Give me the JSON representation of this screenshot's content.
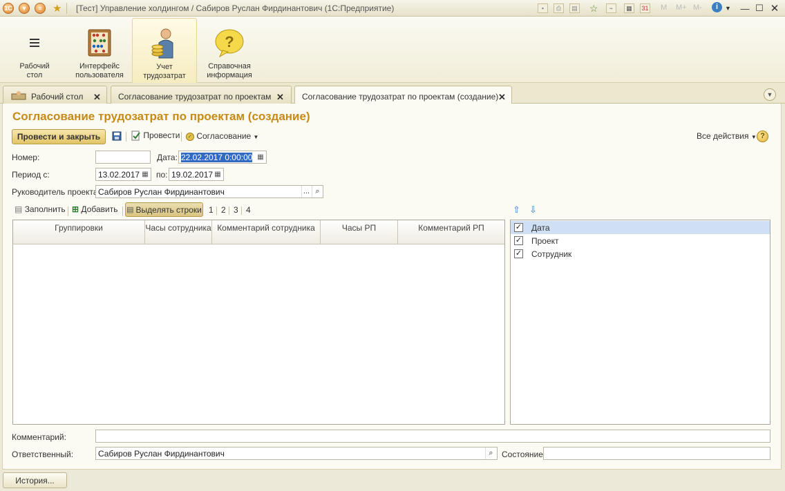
{
  "window": {
    "title": "[Тест] Управление холдингом / Сабиров Руслан Фирдинантович  (1С:Предприятие)",
    "toolbar_glyphs": [
      "M",
      "M+",
      "M-"
    ]
  },
  "sections": [
    {
      "label": "Рабочий\nстол",
      "icon": "menu-lines-icon"
    },
    {
      "label": "Интерфейс\nпользователя",
      "icon": "abacus-icon"
    },
    {
      "label": "Учет\nтрудозатрат",
      "icon": "worker-coins-icon"
    },
    {
      "label": "Справочная\nинформация",
      "icon": "question-bubble-icon"
    }
  ],
  "tabs": [
    {
      "label": "Рабочий стол"
    },
    {
      "label": "Согласование трудозатрат по проектам"
    },
    {
      "label": "Согласование трудозатрат по проектам (создание)"
    }
  ],
  "form": {
    "title": "Согласование трудозатрат по проектам (создание)",
    "toolbar": {
      "post_and_close": "Провести и закрыть",
      "post": "Провести",
      "approval": "Согласование",
      "all_actions": "Все действия",
      "help": "?"
    },
    "number_label": "Номер:",
    "number_value": "",
    "date_label": "Дата:",
    "date_value": "22.02.2017  0:00:00",
    "period_label": "Период с:",
    "period_from": "13.02.2017",
    "period_to_label": "по:",
    "period_to": "19.02.2017",
    "manager_label": "Руководитель проекта:",
    "manager_value": "Сабиров Руслан Фирдинантович",
    "select_button": "...",
    "grid_toolbar": {
      "fill": "Заполнить",
      "add": "Добавить",
      "highlight": "Выделять строки",
      "levels": [
        "1",
        "2",
        "3",
        "4"
      ]
    },
    "grid_columns": [
      "Группировки",
      "Часы сотрудника",
      "Комментарий сотрудника",
      "Часы РП",
      "Комментарий РП"
    ],
    "groupings": [
      {
        "label": "Дата",
        "checked": true,
        "selected": true
      },
      {
        "label": "Проект",
        "checked": true,
        "selected": false
      },
      {
        "label": "Сотрудник",
        "checked": true,
        "selected": false
      }
    ],
    "comment_label": "Комментарий:",
    "comment_value": "",
    "responsible_label": "Ответственный:",
    "responsible_value": "Сабиров Руслан Фирдинантович",
    "state_label": "Состояние:",
    "state_value": ""
  },
  "statusbar": {
    "history_button": "История..."
  },
  "colors": {
    "title_accent": "#c78a16",
    "selection": "#cfe0f5"
  }
}
